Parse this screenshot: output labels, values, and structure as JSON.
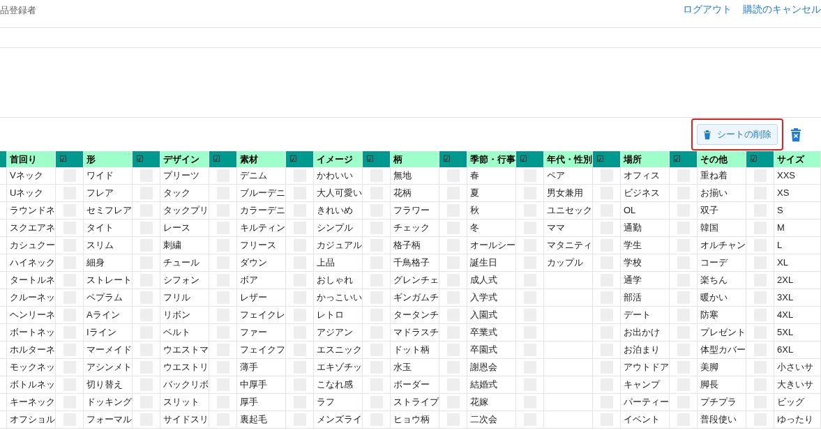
{
  "header": {
    "title": "品登録者",
    "links": [
      "ログアウト",
      "購読のキャンセル"
    ]
  },
  "toolbar": {
    "delete_button": {
      "label": "シートの削除",
      "highlighted": true
    }
  },
  "table": {
    "columns": [
      {
        "header": "首回り",
        "check_header": "☑",
        "checked": [
          false,
          false,
          false,
          false,
          false,
          false,
          false,
          false,
          false,
          false,
          false,
          false,
          false,
          false,
          false
        ],
        "values": [
          "Vネック",
          "Uネック",
          "ラウンドネ",
          "スクエアネ",
          "カシュクー",
          "ハイネック",
          "タートルネ",
          "クルーネッ",
          "ヘンリーネ",
          "ボートネッ",
          "ホルターネ",
          "モックネッ",
          "ボトルネッ",
          "キーネック",
          "オフショル"
        ]
      },
      {
        "header": "形",
        "check_header": "☑",
        "checked": [
          false,
          false,
          false,
          false,
          false,
          false,
          false,
          false,
          false,
          false,
          false,
          false,
          false,
          false,
          false
        ],
        "values": [
          "ワイド",
          "フレア",
          "セミフレア",
          "タイト",
          "スリム",
          "細身",
          "ストレート",
          "ペプラム",
          "Aライン",
          "Iライン",
          "マーメイド",
          "アシンメト",
          "切り替え",
          "ドッキング",
          "フォーマル"
        ]
      },
      {
        "header": "デザイン",
        "check_header": "☑",
        "checked": [
          false,
          false,
          false,
          false,
          false,
          false,
          false,
          false,
          false,
          false,
          false,
          false,
          false,
          false,
          false
        ],
        "values": [
          "プリーツ",
          "タック",
          "タックプリ",
          "レース",
          "刺繍",
          "チュール",
          "シフォン",
          "フリル",
          "リボン",
          "ベルト",
          "ウエストマ",
          "ウエストリ",
          "バックリボ",
          "スリット",
          "サイドスリ"
        ]
      },
      {
        "header": "素材",
        "check_header": "☑",
        "checked": [
          false,
          false,
          false,
          false,
          false,
          false,
          false,
          false,
          false,
          false,
          false,
          false,
          false,
          false,
          false
        ],
        "values": [
          "デニム",
          "ブルーデニ",
          "カラーデニ",
          "キルティン",
          "フリース",
          "ダウン",
          "ボア",
          "レザー",
          "フェイクレ",
          "ファー",
          "フェイクフ",
          "薄手",
          "中厚手",
          "厚手",
          "裏起毛"
        ]
      },
      {
        "header": "イメージ",
        "check_header": "☑",
        "checked": [
          false,
          false,
          false,
          false,
          false,
          false,
          false,
          false,
          false,
          false,
          false,
          false,
          false,
          false,
          false
        ],
        "values": [
          "かわいい",
          "大人可愛い",
          "きれいめ",
          "シンプル",
          "カジュアル",
          "上品",
          "おしゃれ",
          "かっこいい",
          "レトロ",
          "アジアン",
          "エスニック",
          "エキゾチッ",
          "こなれ感",
          "ラフ",
          "メンズライ"
        ]
      },
      {
        "header": "柄",
        "check_header": "☑",
        "checked": [
          false,
          false,
          false,
          false,
          false,
          false,
          false,
          false,
          false,
          false,
          false,
          false,
          false,
          false,
          false
        ],
        "values": [
          "無地",
          "花柄",
          "フラワー",
          "チェック",
          "格子柄",
          "千鳥格子",
          "グレンチェ",
          "ギンガムチ",
          "タータンチ",
          "マドラスチ",
          "ドット柄",
          "水玉",
          "ボーダー",
          "ストライプ",
          "ヒョウ柄"
        ]
      },
      {
        "header": "季節・行事",
        "check_header": "☑",
        "checked": [
          false,
          false,
          false,
          false,
          false,
          false,
          false,
          false,
          false,
          false,
          false,
          false,
          false,
          false,
          false
        ],
        "values": [
          "春",
          "夏",
          "秋",
          "冬",
          "オールシー",
          "誕生日",
          "成人式",
          "入学式",
          "入園式",
          "卒業式",
          "卒園式",
          "謝恩会",
          "結婚式",
          "花嫁",
          "二次会"
        ]
      },
      {
        "header": "年代・性別",
        "check_header": "☑",
        "checked": [
          false,
          false,
          false,
          false,
          false,
          false,
          false,
          false,
          false,
          false,
          false,
          false,
          false,
          false,
          false
        ],
        "values": [
          "ペア",
          "男女兼用",
          "ユニセック",
          "ママ",
          "マタニティ",
          "カップル"
        ]
      },
      {
        "header": "場所",
        "check_header": "☑",
        "checked": [
          false,
          false,
          false,
          false,
          false,
          false,
          false,
          false,
          false,
          false,
          false,
          false,
          false,
          false,
          false
        ],
        "values": [
          "オフィス",
          "ビジネス",
          "OL",
          "通勤",
          "学生",
          "学校",
          "通学",
          "部活",
          "デート",
          "お出かけ",
          "お泊まり",
          "アウトドア",
          "キャンプ",
          "パーティー",
          "イベント"
        ]
      },
      {
        "header": "その他",
        "check_header": "☑",
        "checked": [
          false,
          false,
          false,
          false,
          false,
          false,
          false,
          false,
          false,
          false,
          false,
          false,
          false,
          false,
          false
        ],
        "values": [
          "重ね着",
          "お揃い",
          "双子",
          "韓国",
          "オルチャン",
          "コーデ",
          "楽ちん",
          "暖かい",
          "防寒",
          "プレゼント",
          "体型カバー",
          "美脚",
          "脚長",
          "プチプラ",
          "普段使い"
        ]
      },
      {
        "header": "サイズ",
        "values": [
          "XXS",
          "XS",
          "S",
          "M",
          "L",
          "XL",
          "2XL",
          "3XL",
          "4XL",
          "5XL",
          "6XL",
          "小さいサ",
          "大きいサ",
          "ビッグ",
          "ゆったり"
        ]
      }
    ]
  }
}
